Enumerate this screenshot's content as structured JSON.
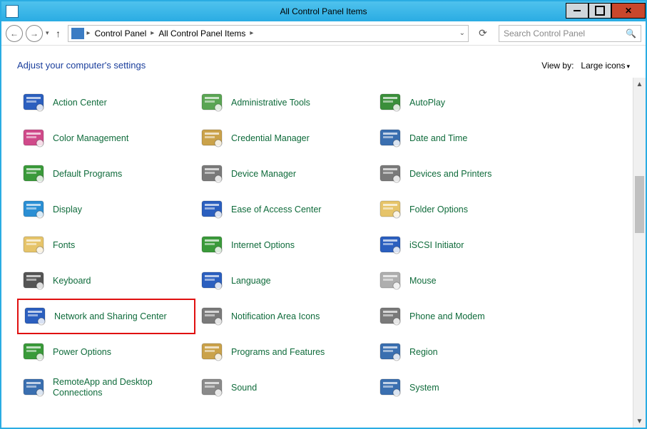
{
  "window": {
    "title": "All Control Panel Items"
  },
  "nav": {
    "crumb1": "Control Panel",
    "crumb2": "All Control Panel Items",
    "search_placeholder": "Search Control Panel"
  },
  "header": {
    "title": "Adjust your computer's settings",
    "viewby_label": "View by:",
    "viewby_value": "Large icons"
  },
  "items": [
    {
      "label": "Action Center",
      "iconColor": "#2b5fbf"
    },
    {
      "label": "Administrative Tools",
      "iconColor": "#5aa553"
    },
    {
      "label": "AutoPlay",
      "iconColor": "#3a8f3a"
    },
    {
      "label": "Color Management",
      "iconColor": "#d04a8a"
    },
    {
      "label": "Credential Manager",
      "iconColor": "#caa24a"
    },
    {
      "label": "Date and Time",
      "iconColor": "#3a6fb0"
    },
    {
      "label": "Default Programs",
      "iconColor": "#3a9a3a"
    },
    {
      "label": "Device Manager",
      "iconColor": "#7a7a7a"
    },
    {
      "label": "Devices and Printers",
      "iconColor": "#7a7a7a"
    },
    {
      "label": "Display",
      "iconColor": "#2b8fd4"
    },
    {
      "label": "Ease of Access Center",
      "iconColor": "#2b5fbf"
    },
    {
      "label": "Folder Options",
      "iconColor": "#e6c46a"
    },
    {
      "label": "Fonts",
      "iconColor": "#e6c46a"
    },
    {
      "label": "Internet Options",
      "iconColor": "#3a9a3a"
    },
    {
      "label": "iSCSI Initiator",
      "iconColor": "#2b5fbf"
    },
    {
      "label": "Keyboard",
      "iconColor": "#555555"
    },
    {
      "label": "Language",
      "iconColor": "#2b5fbf"
    },
    {
      "label": "Mouse",
      "iconColor": "#aeaeae"
    },
    {
      "label": "Network and Sharing Center",
      "iconColor": "#2b5fbf",
      "highlight": true
    },
    {
      "label": "Notification Area Icons",
      "iconColor": "#7a7a7a"
    },
    {
      "label": "Phone and Modem",
      "iconColor": "#7a7a7a"
    },
    {
      "label": "Power Options",
      "iconColor": "#3a9a3a"
    },
    {
      "label": "Programs and Features",
      "iconColor": "#caa24a"
    },
    {
      "label": "Region",
      "iconColor": "#3a6fb0"
    },
    {
      "label": "RemoteApp and Desktop Connections",
      "iconColor": "#3a6fb0"
    },
    {
      "label": "Sound",
      "iconColor": "#8a8a8a"
    },
    {
      "label": "System",
      "iconColor": "#3a6fb0"
    }
  ]
}
